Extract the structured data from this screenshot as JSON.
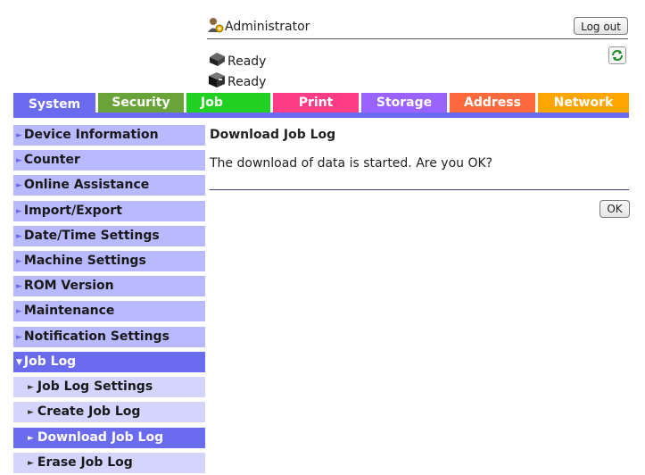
{
  "header": {
    "user_label": "Administrator",
    "logout_label": "Log out",
    "status_lines": [
      "Ready",
      "Ready"
    ]
  },
  "tabs": [
    {
      "label": "System",
      "color": "#6b6bf0",
      "active": true
    },
    {
      "label": "Security",
      "color": "#6aa33a"
    },
    {
      "label": "Job",
      "color": "#22d022"
    },
    {
      "label": "Print",
      "color": "#ff3d87"
    },
    {
      "label": "Storage",
      "color": "#9a62ff"
    },
    {
      "label": "Address",
      "color": "#ff6a3c"
    },
    {
      "label": "Network",
      "color": "#ffa500"
    }
  ],
  "sidebar": {
    "items": [
      {
        "label": "Device Information"
      },
      {
        "label": "Counter"
      },
      {
        "label": "Online Assistance"
      },
      {
        "label": "Import/Export"
      },
      {
        "label": "Date/Time Settings"
      },
      {
        "label": "Machine Settings"
      },
      {
        "label": "ROM Version"
      },
      {
        "label": "Maintenance"
      },
      {
        "label": "Notification Settings"
      },
      {
        "label": "Job Log",
        "expanded": true
      }
    ],
    "subitems": [
      {
        "label": "Job Log Settings"
      },
      {
        "label": "Create Job Log"
      },
      {
        "label": "Download Job Log",
        "active": true
      },
      {
        "label": "Erase Job Log"
      }
    ]
  },
  "main": {
    "title": "Download Job Log",
    "message": "The download of data is started. Are you OK?",
    "ok_label": "OK"
  }
}
